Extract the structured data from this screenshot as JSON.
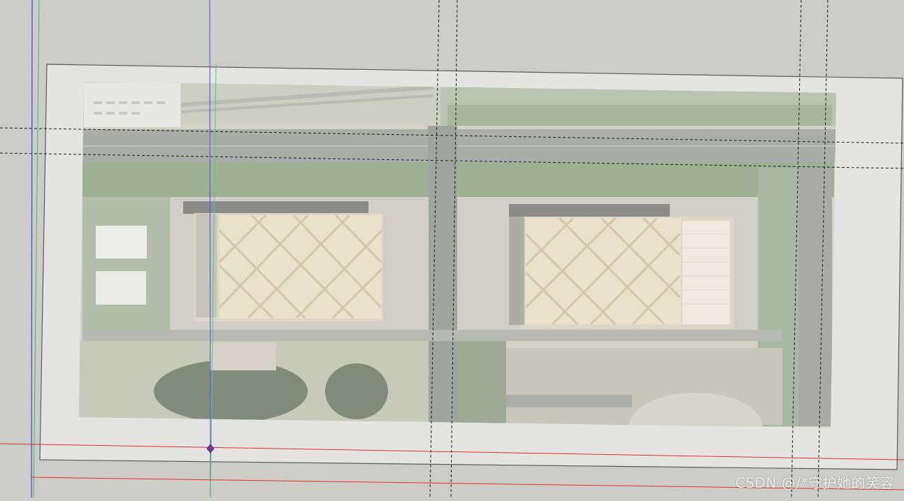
{
  "watermark": "CSDN @/*守护她的笑容",
  "colors": {
    "background": "#cccdc8",
    "sheet": "#e4e4e2",
    "sheet_edge": "#5a5a5a",
    "guide_line": "#111111",
    "axis_red": "#e03030",
    "axis_green": "#40c040",
    "axis_blue": "#3a3aff",
    "point_marker": "#7a3a9a",
    "trees": "#5d7f4f",
    "road": "#8e918c",
    "roof": "#e9dcc2",
    "water": "#4f5d47"
  }
}
